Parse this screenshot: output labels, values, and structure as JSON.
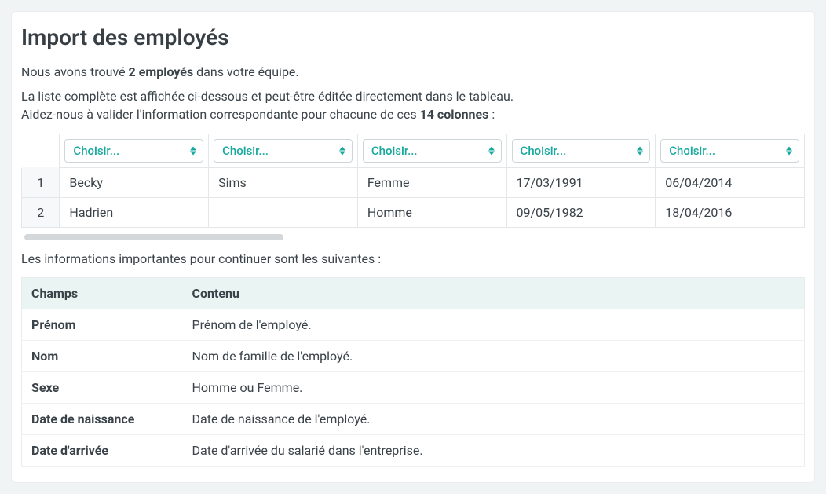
{
  "title": "Import des employés",
  "intro": {
    "found_prefix": "Nous avons trouvé ",
    "found_bold": "2 employés",
    "found_suffix": " dans votre équipe.",
    "list_text": "La liste complète est affichée ci-dessous et peut-être éditée directement dans le tableau.",
    "help_prefix": "Aidez-nous à valider l'information correspondante pour chacune de ces ",
    "help_bold": "14 colonnes",
    "help_suffix": " :"
  },
  "selector_label": "Choisir...",
  "visible_columns": 5,
  "data_rows": [
    {
      "no": "1",
      "cells": [
        "Becky",
        "Sims",
        "Femme",
        "17/03/1991",
        "06/04/2014"
      ]
    },
    {
      "no": "2",
      "cells": [
        "Hadrien",
        "",
        "Homme",
        "09/05/1982",
        "18/04/2016"
      ]
    }
  ],
  "info_lead": "Les informations importantes pour continuer sont les suivantes :",
  "fields_header": {
    "champs": "Champs",
    "contenu": "Contenu"
  },
  "fields": [
    {
      "name": "Prénom",
      "desc": "Prénom de l'employé."
    },
    {
      "name": "Nom",
      "desc": "Nom de famille de l'employé."
    },
    {
      "name": "Sexe",
      "desc": "Homme ou Femme."
    },
    {
      "name": "Date de naissance",
      "desc": "Date de naissance de l'employé."
    },
    {
      "name": "Date d'arrivée",
      "desc": "Date d'arrivée du salarié dans l'entreprise."
    }
  ],
  "colors": {
    "accent": "#18a99e"
  },
  "chart_data": {
    "type": "table",
    "title": "Import des employés — aperçu",
    "columns_total": 14,
    "columns_visible": [
      "Prénom",
      "Nom",
      "Sexe",
      "Date de naissance",
      "Date d'arrivée"
    ],
    "rows": [
      [
        "Becky",
        "Sims",
        "Femme",
        "17/03/1991",
        "06/04/2014"
      ],
      [
        "Hadrien",
        "",
        "Homme",
        "09/05/1982",
        "18/04/2016"
      ]
    ]
  }
}
